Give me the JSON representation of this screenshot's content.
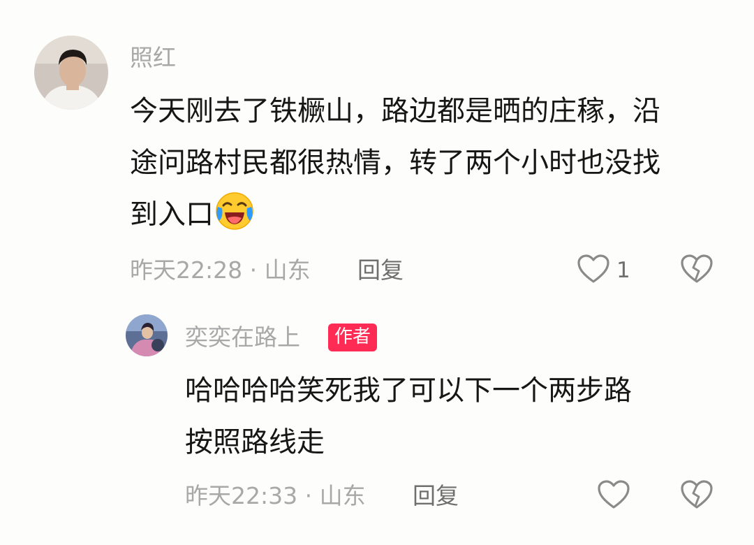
{
  "comment": {
    "username": "照红",
    "lines": [
      "今天刚去了铁橛山，路边都是晒的庄稼，沿",
      "途问路村民都很热情，转了两个小时也没找",
      "到入口"
    ],
    "emoji": "laughing-crying-emoji",
    "meta": "昨天22:28 · 山东",
    "reply_label": "回复",
    "like_count": "1"
  },
  "reply": {
    "username": "奕奕在路上",
    "badge": "作者",
    "lines": [
      "哈哈哈哈笑死我了可以下一个两步路",
      "按照路线走"
    ],
    "meta": "昨天22:33 · 山东",
    "reply_label": "回复"
  },
  "colors": {
    "badge": "#fe2c55",
    "muted": "#a8a8a8",
    "text": "#161616"
  }
}
